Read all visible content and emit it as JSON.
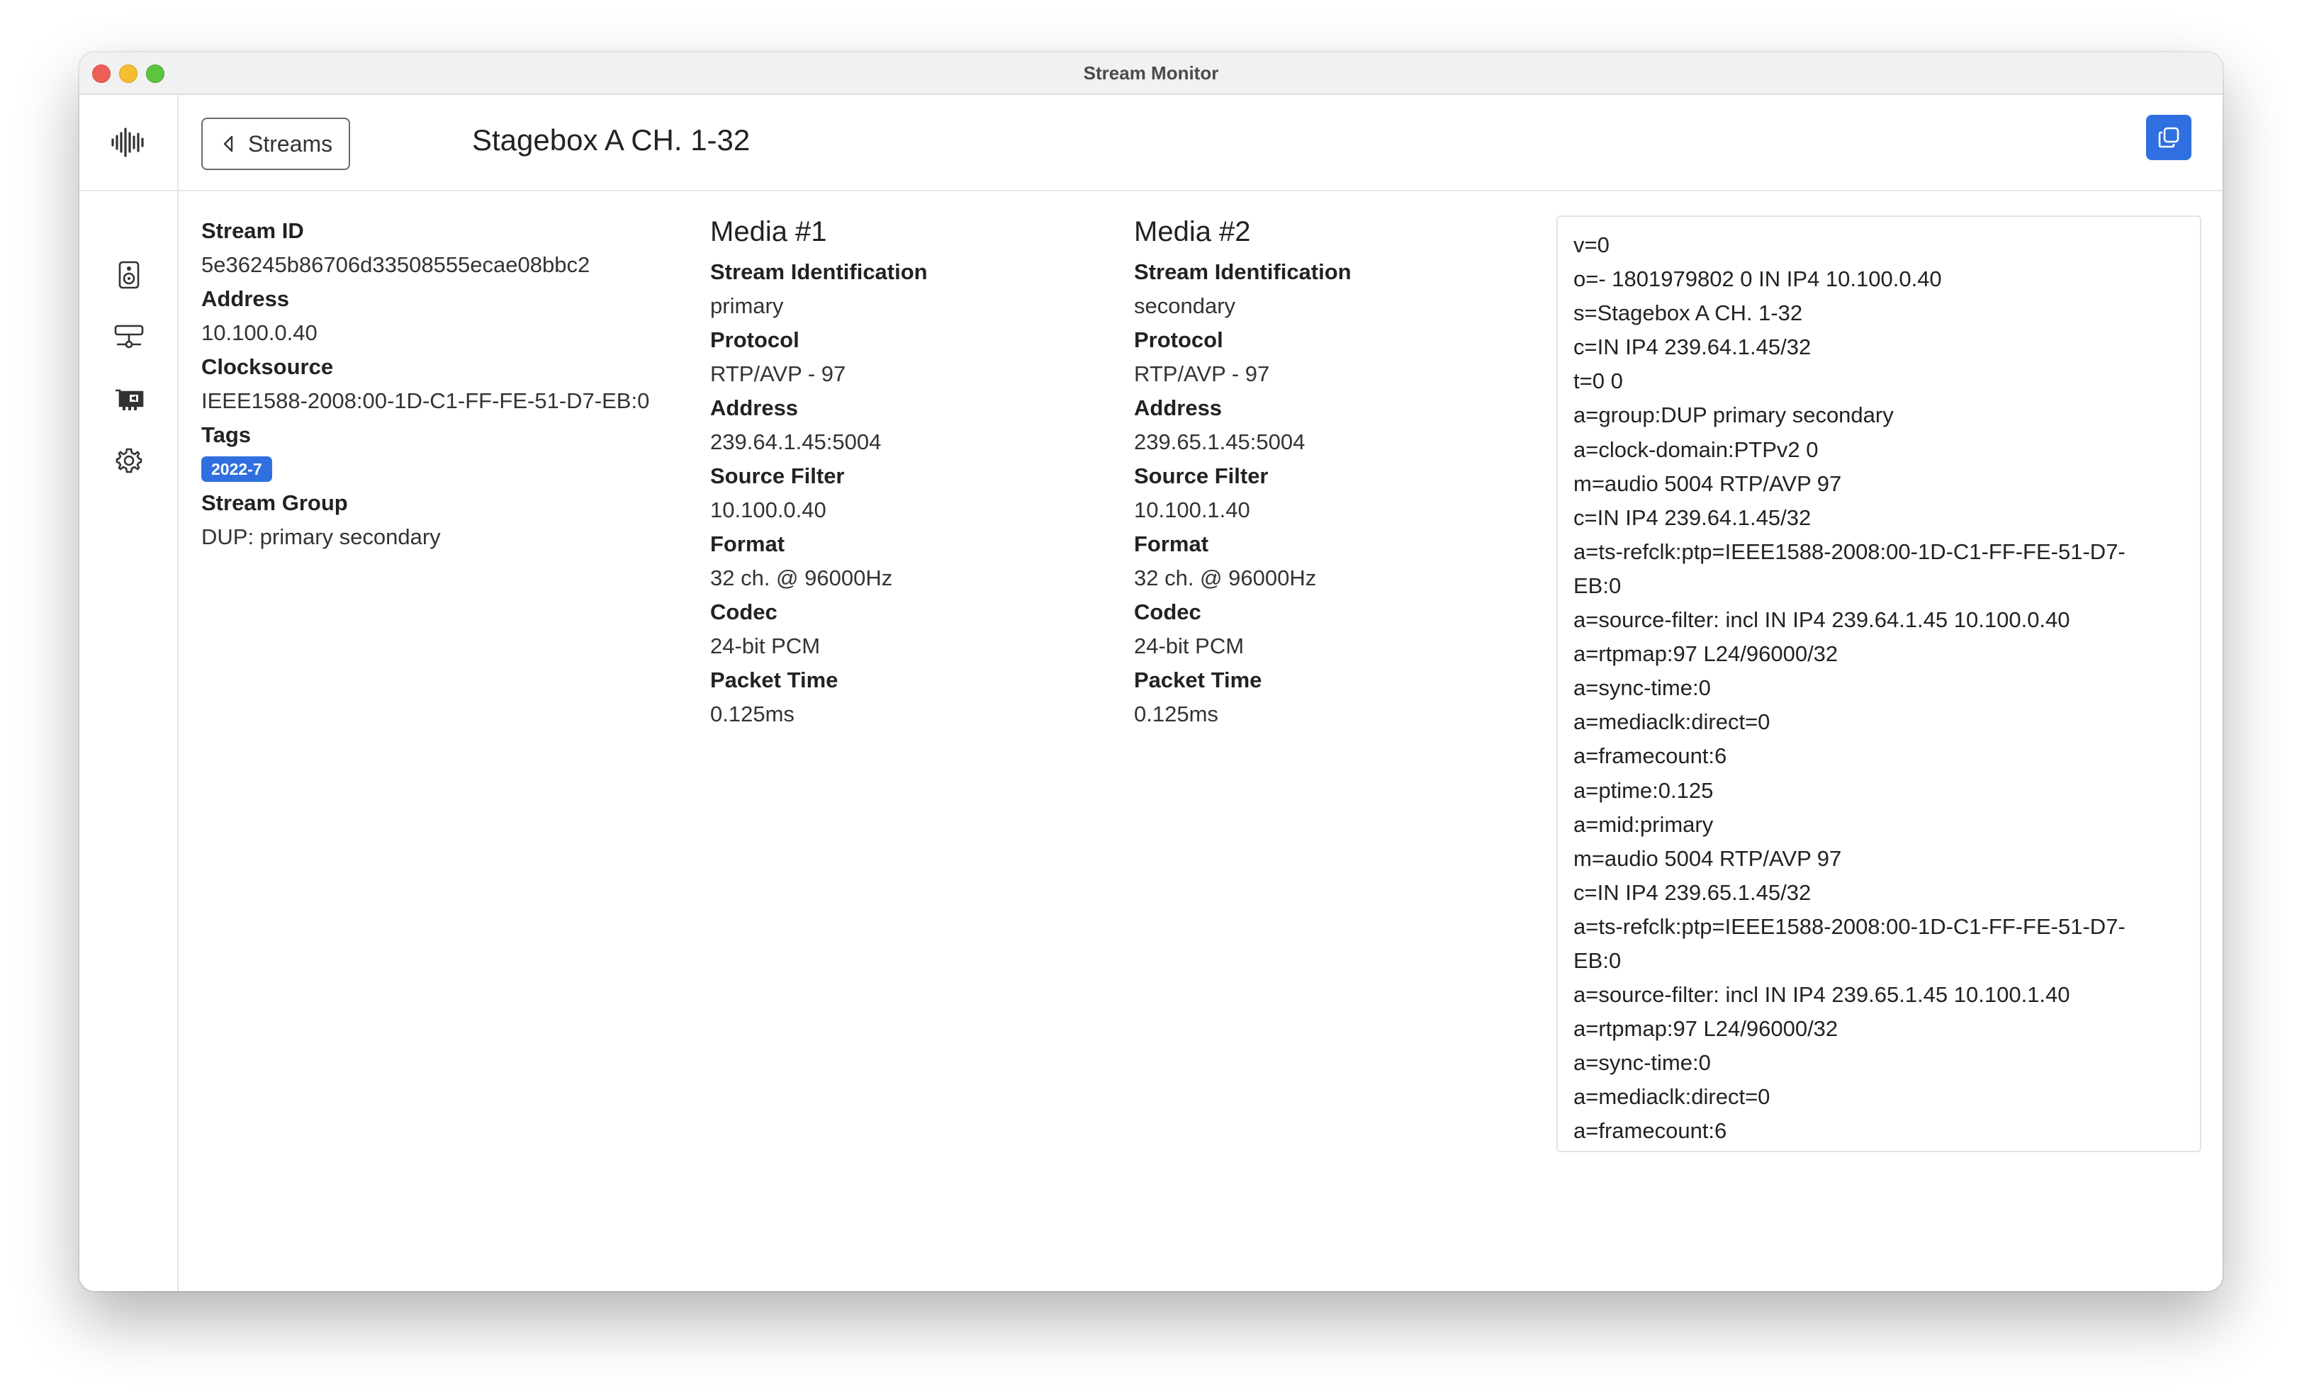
{
  "window": {
    "title": "Stream Monitor"
  },
  "header": {
    "back_label": "Streams",
    "title": "Stagebox A CH. 1-32"
  },
  "sidebar": {
    "items": [
      {
        "icon": "speaker-icon"
      },
      {
        "icon": "network-icon"
      },
      {
        "icon": "sound-card-icon"
      },
      {
        "icon": "gear-icon"
      }
    ]
  },
  "stream": {
    "stream_id_label": "Stream ID",
    "stream_id": "5e36245b86706d33508555ecae08bbc2",
    "address_label": "Address",
    "address": "10.100.0.40",
    "clocksource_label": "Clocksource",
    "clocksource": "IEEE1588-2008:00-1D-C1-FF-FE-51-D7-EB:0",
    "tags_label": "Tags",
    "tag": "2022-7",
    "group_label": "Stream Group",
    "group": "DUP: primary secondary"
  },
  "media": [
    {
      "title": "Media #1",
      "ident_label": "Stream Identification",
      "ident": "primary",
      "protocol_label": "Protocol",
      "protocol": "RTP/AVP - 97",
      "address_label": "Address",
      "address": "239.64.1.45:5004",
      "filter_label": "Source Filter",
      "filter": "10.100.0.40",
      "format_label": "Format",
      "format": "32 ch. @ 96000Hz",
      "codec_label": "Codec",
      "codec": "24-bit PCM",
      "ptime_label": "Packet Time",
      "ptime": "0.125ms"
    },
    {
      "title": "Media #2",
      "ident_label": "Stream Identification",
      "ident": "secondary",
      "protocol_label": "Protocol",
      "protocol": "RTP/AVP - 97",
      "address_label": "Address",
      "address": "239.65.1.45:5004",
      "filter_label": "Source Filter",
      "filter": "10.100.1.40",
      "format_label": "Format",
      "format": "32 ch. @ 96000Hz",
      "codec_label": "Codec",
      "codec": "24-bit PCM",
      "ptime_label": "Packet Time",
      "ptime": "0.125ms"
    }
  ],
  "sdp": [
    "v=0",
    "o=- 1801979802 0 IN IP4 10.100.0.40",
    "s=Stagebox A CH. 1-32",
    "c=IN IP4 239.64.1.45/32",
    "t=0 0",
    "a=group:DUP primary secondary",
    "a=clock-domain:PTPv2 0",
    "m=audio 5004 RTP/AVP 97",
    "c=IN IP4 239.64.1.45/32",
    "a=ts-refclk:ptp=IEEE1588-2008:00-1D-C1-FF-FE-51-D7-",
    "EB:0",
    "a=source-filter: incl IN IP4 239.64.1.45 10.100.0.40",
    "a=rtpmap:97 L24/96000/32",
    "a=sync-time:0",
    "a=mediaclk:direct=0",
    "a=framecount:6",
    "a=ptime:0.125",
    "a=mid:primary",
    "m=audio 5004 RTP/AVP 97",
    "c=IN IP4 239.65.1.45/32",
    "a=ts-refclk:ptp=IEEE1588-2008:00-1D-C1-FF-FE-51-D7-",
    "EB:0",
    "a=source-filter: incl IN IP4 239.65.1.45 10.100.1.40",
    "a=rtpmap:97 L24/96000/32",
    "a=sync-time:0",
    "a=mediaclk:direct=0",
    "a=framecount:6"
  ],
  "colors": {
    "accent": "#2f6fe0",
    "traffic_red": "#ee5f57",
    "traffic_yellow": "#f5bd2f",
    "traffic_green": "#5cc53f"
  }
}
